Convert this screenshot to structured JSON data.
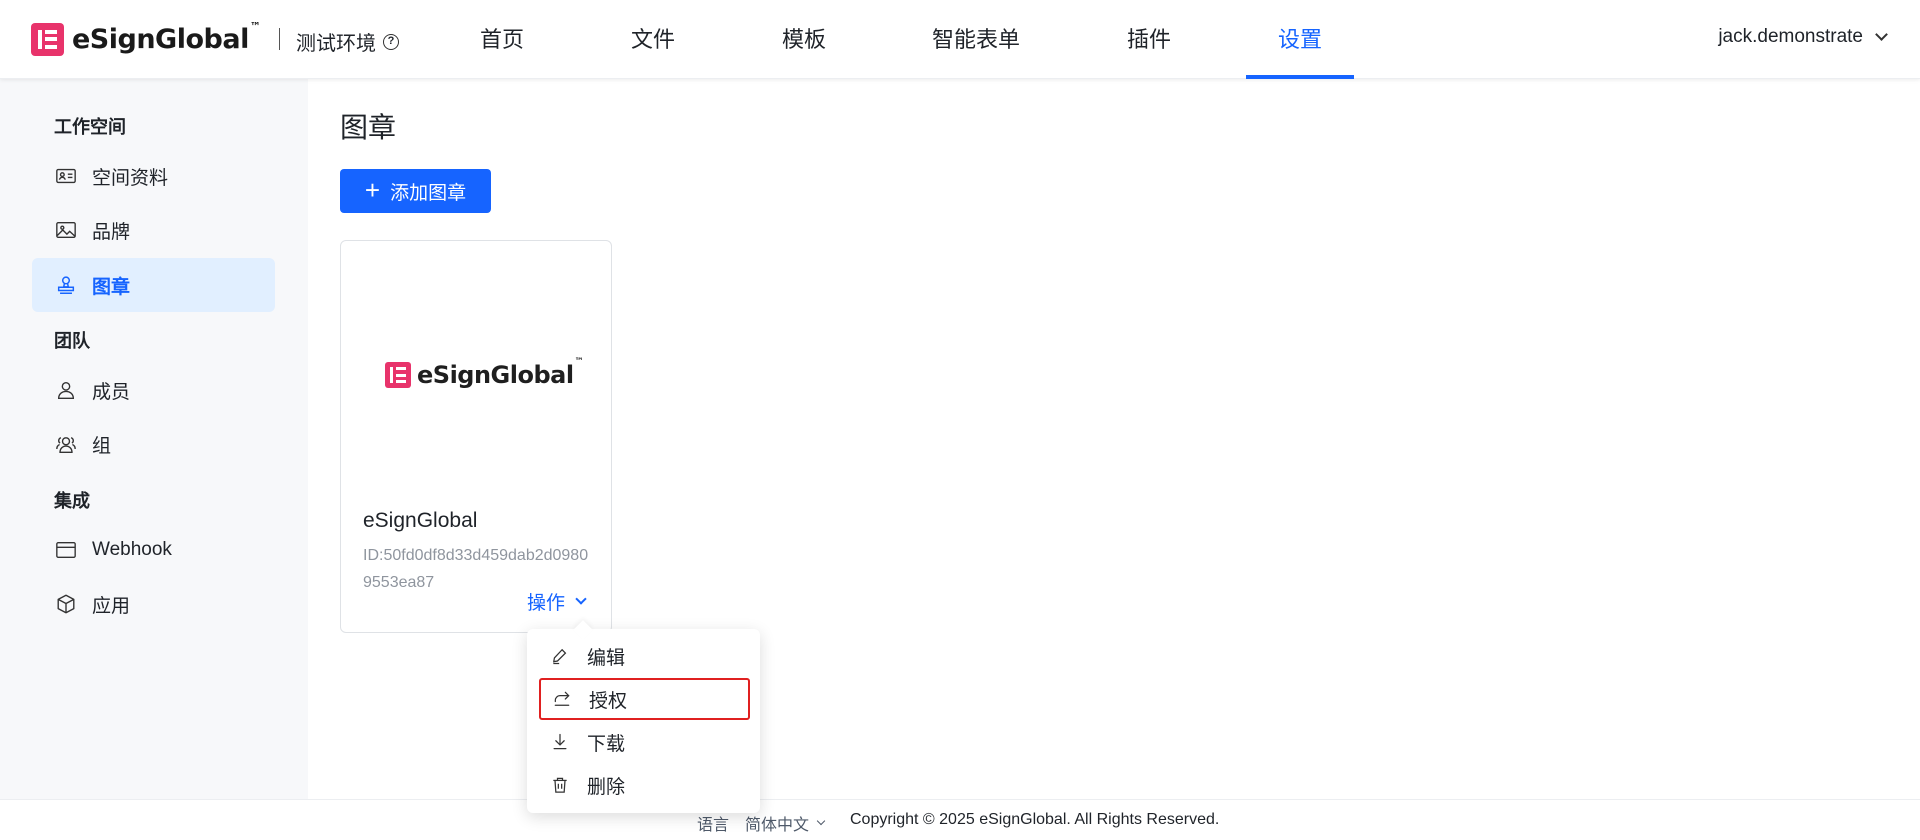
{
  "header": {
    "brand": "eSignGlobal",
    "trademark": "™",
    "environment": "测试环境",
    "help_glyph": "?",
    "nav": [
      {
        "label": "首页",
        "active": false
      },
      {
        "label": "文件",
        "active": false
      },
      {
        "label": "模板",
        "active": false
      },
      {
        "label": "智能表单",
        "active": false
      },
      {
        "label": "插件",
        "active": false
      },
      {
        "label": "设置",
        "active": true
      }
    ],
    "user": "jack.demonstrate",
    "colors": {
      "brand": "#e8336b",
      "accent": "#1664ff"
    }
  },
  "sidebar": {
    "groups": [
      {
        "title": "工作空间",
        "items": [
          {
            "label": "空间资料",
            "icon": "id-card-icon",
            "active": false
          },
          {
            "label": "品牌",
            "icon": "image-icon",
            "active": false
          },
          {
            "label": "图章",
            "icon": "stamp-icon",
            "active": true
          }
        ]
      },
      {
        "title": "团队",
        "items": [
          {
            "label": "成员",
            "icon": "user-icon",
            "active": false
          },
          {
            "label": "组",
            "icon": "group-icon",
            "active": false
          }
        ]
      },
      {
        "title": "集成",
        "items": [
          {
            "label": "Webhook",
            "icon": "window-icon",
            "active": false
          },
          {
            "label": "应用",
            "icon": "cube-icon",
            "active": false
          }
        ]
      }
    ]
  },
  "main": {
    "title": "图章",
    "add_button": {
      "icon": "+",
      "label": "添加图章"
    },
    "stamp_card": {
      "logo_text": "eSignGlobal",
      "logo_tm": "™",
      "name": "eSignGlobal",
      "id_text": "ID:50fd0df8d33d459dab2d09809553ea87",
      "action_label": "操作"
    },
    "action_menu": [
      {
        "label": "编辑",
        "icon": "edit-icon",
        "highlighted": false
      },
      {
        "label": "授权",
        "icon": "share-icon",
        "highlighted": true
      },
      {
        "label": "下载",
        "icon": "download-icon",
        "highlighted": false
      },
      {
        "label": "删除",
        "icon": "delete-icon",
        "highlighted": false
      }
    ]
  },
  "footer": {
    "language_label": "语言",
    "language_value": "简体中文",
    "copyright": "Copyright © 2025 eSignGlobal. All Rights Reserved."
  }
}
